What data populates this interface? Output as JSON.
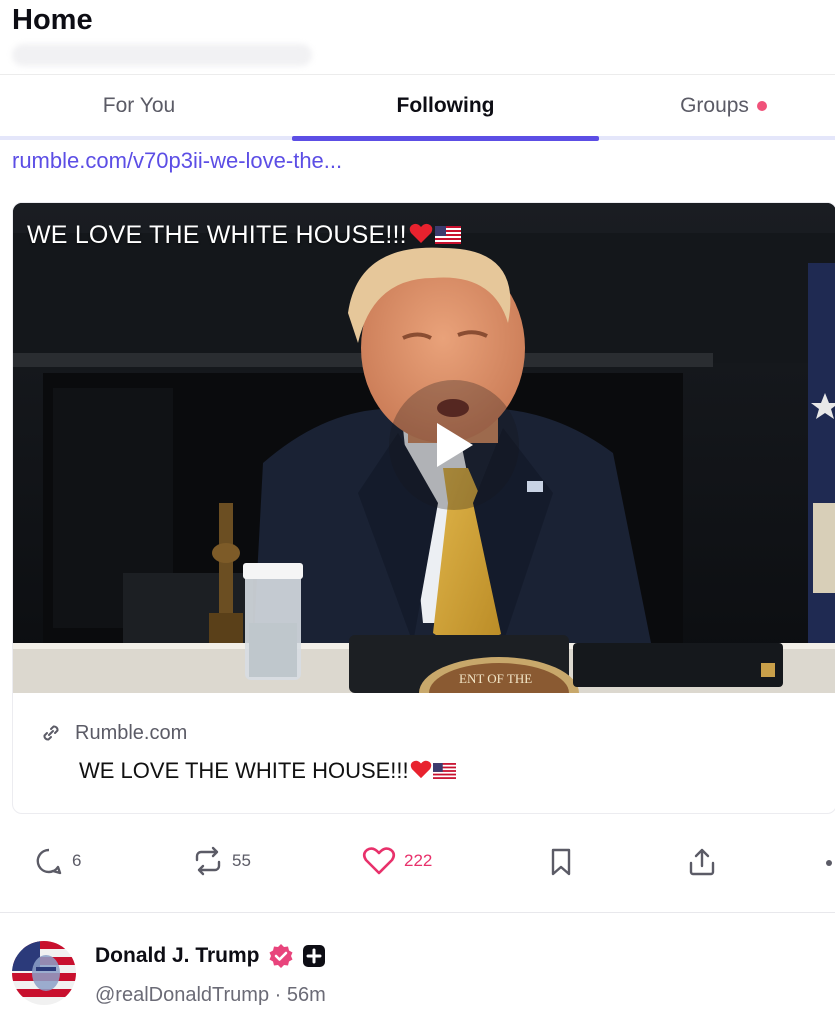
{
  "header": {
    "title": "Home"
  },
  "tabs": [
    {
      "label": "For You",
      "active": false
    },
    {
      "label": "Following",
      "active": true
    },
    {
      "label": "Groups",
      "active": false,
      "has_notification_dot": true
    }
  ],
  "post": {
    "link_text": "rumble.com/v70p3ii-we-love-the...",
    "video": {
      "caption": "WE LOVE THE WHITE HOUSE!!!",
      "caption_emojis": [
        "red-heart",
        "us-flag"
      ],
      "seal_text": "ENT OF THE"
    },
    "link_preview": {
      "domain": "Rumble.com",
      "title": "WE LOVE THE WHITE HOUSE!!!",
      "title_emojis": [
        "red-heart",
        "us-flag"
      ]
    },
    "actions": {
      "replies": "6",
      "reposts": "55",
      "likes": "222",
      "liked": true
    }
  },
  "next_post": {
    "author_name": "Donald J. Trump",
    "handle_line": "@realDonaldTrump · 56m",
    "verified": true
  },
  "colors": {
    "accent": "#5c4ee5",
    "like": "#e8316b",
    "notification_dot": "#f0527a",
    "verified_badge": "#e8447c"
  }
}
